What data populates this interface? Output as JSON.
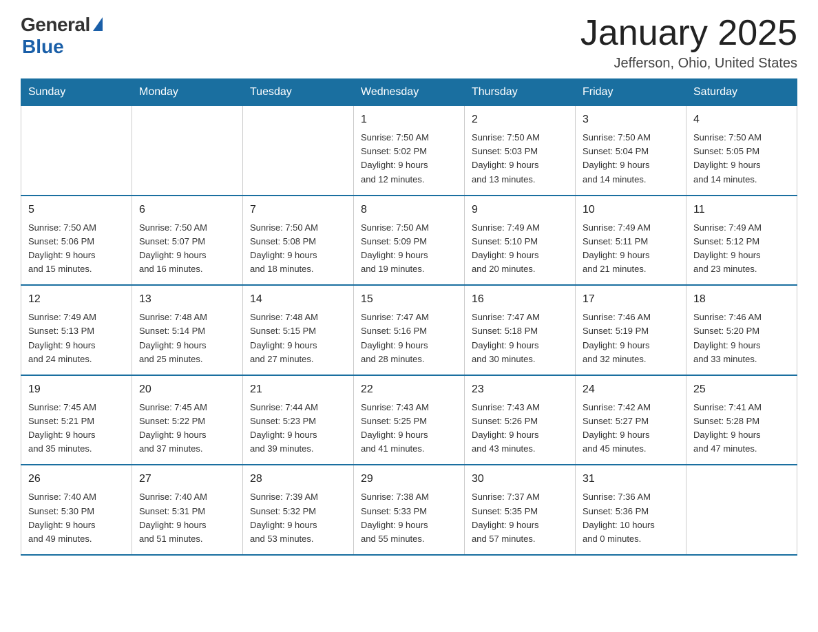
{
  "logo": {
    "general": "General",
    "blue": "Blue"
  },
  "title": "January 2025",
  "subtitle": "Jefferson, Ohio, United States",
  "header_days": [
    "Sunday",
    "Monday",
    "Tuesday",
    "Wednesday",
    "Thursday",
    "Friday",
    "Saturday"
  ],
  "weeks": [
    [
      {
        "day": "",
        "info": ""
      },
      {
        "day": "",
        "info": ""
      },
      {
        "day": "",
        "info": ""
      },
      {
        "day": "1",
        "info": "Sunrise: 7:50 AM\nSunset: 5:02 PM\nDaylight: 9 hours\nand 12 minutes."
      },
      {
        "day": "2",
        "info": "Sunrise: 7:50 AM\nSunset: 5:03 PM\nDaylight: 9 hours\nand 13 minutes."
      },
      {
        "day": "3",
        "info": "Sunrise: 7:50 AM\nSunset: 5:04 PM\nDaylight: 9 hours\nand 14 minutes."
      },
      {
        "day": "4",
        "info": "Sunrise: 7:50 AM\nSunset: 5:05 PM\nDaylight: 9 hours\nand 14 minutes."
      }
    ],
    [
      {
        "day": "5",
        "info": "Sunrise: 7:50 AM\nSunset: 5:06 PM\nDaylight: 9 hours\nand 15 minutes."
      },
      {
        "day": "6",
        "info": "Sunrise: 7:50 AM\nSunset: 5:07 PM\nDaylight: 9 hours\nand 16 minutes."
      },
      {
        "day": "7",
        "info": "Sunrise: 7:50 AM\nSunset: 5:08 PM\nDaylight: 9 hours\nand 18 minutes."
      },
      {
        "day": "8",
        "info": "Sunrise: 7:50 AM\nSunset: 5:09 PM\nDaylight: 9 hours\nand 19 minutes."
      },
      {
        "day": "9",
        "info": "Sunrise: 7:49 AM\nSunset: 5:10 PM\nDaylight: 9 hours\nand 20 minutes."
      },
      {
        "day": "10",
        "info": "Sunrise: 7:49 AM\nSunset: 5:11 PM\nDaylight: 9 hours\nand 21 minutes."
      },
      {
        "day": "11",
        "info": "Sunrise: 7:49 AM\nSunset: 5:12 PM\nDaylight: 9 hours\nand 23 minutes."
      }
    ],
    [
      {
        "day": "12",
        "info": "Sunrise: 7:49 AM\nSunset: 5:13 PM\nDaylight: 9 hours\nand 24 minutes."
      },
      {
        "day": "13",
        "info": "Sunrise: 7:48 AM\nSunset: 5:14 PM\nDaylight: 9 hours\nand 25 minutes."
      },
      {
        "day": "14",
        "info": "Sunrise: 7:48 AM\nSunset: 5:15 PM\nDaylight: 9 hours\nand 27 minutes."
      },
      {
        "day": "15",
        "info": "Sunrise: 7:47 AM\nSunset: 5:16 PM\nDaylight: 9 hours\nand 28 minutes."
      },
      {
        "day": "16",
        "info": "Sunrise: 7:47 AM\nSunset: 5:18 PM\nDaylight: 9 hours\nand 30 minutes."
      },
      {
        "day": "17",
        "info": "Sunrise: 7:46 AM\nSunset: 5:19 PM\nDaylight: 9 hours\nand 32 minutes."
      },
      {
        "day": "18",
        "info": "Sunrise: 7:46 AM\nSunset: 5:20 PM\nDaylight: 9 hours\nand 33 minutes."
      }
    ],
    [
      {
        "day": "19",
        "info": "Sunrise: 7:45 AM\nSunset: 5:21 PM\nDaylight: 9 hours\nand 35 minutes."
      },
      {
        "day": "20",
        "info": "Sunrise: 7:45 AM\nSunset: 5:22 PM\nDaylight: 9 hours\nand 37 minutes."
      },
      {
        "day": "21",
        "info": "Sunrise: 7:44 AM\nSunset: 5:23 PM\nDaylight: 9 hours\nand 39 minutes."
      },
      {
        "day": "22",
        "info": "Sunrise: 7:43 AM\nSunset: 5:25 PM\nDaylight: 9 hours\nand 41 minutes."
      },
      {
        "day": "23",
        "info": "Sunrise: 7:43 AM\nSunset: 5:26 PM\nDaylight: 9 hours\nand 43 minutes."
      },
      {
        "day": "24",
        "info": "Sunrise: 7:42 AM\nSunset: 5:27 PM\nDaylight: 9 hours\nand 45 minutes."
      },
      {
        "day": "25",
        "info": "Sunrise: 7:41 AM\nSunset: 5:28 PM\nDaylight: 9 hours\nand 47 minutes."
      }
    ],
    [
      {
        "day": "26",
        "info": "Sunrise: 7:40 AM\nSunset: 5:30 PM\nDaylight: 9 hours\nand 49 minutes."
      },
      {
        "day": "27",
        "info": "Sunrise: 7:40 AM\nSunset: 5:31 PM\nDaylight: 9 hours\nand 51 minutes."
      },
      {
        "day": "28",
        "info": "Sunrise: 7:39 AM\nSunset: 5:32 PM\nDaylight: 9 hours\nand 53 minutes."
      },
      {
        "day": "29",
        "info": "Sunrise: 7:38 AM\nSunset: 5:33 PM\nDaylight: 9 hours\nand 55 minutes."
      },
      {
        "day": "30",
        "info": "Sunrise: 7:37 AM\nSunset: 5:35 PM\nDaylight: 9 hours\nand 57 minutes."
      },
      {
        "day": "31",
        "info": "Sunrise: 7:36 AM\nSunset: 5:36 PM\nDaylight: 10 hours\nand 0 minutes."
      },
      {
        "day": "",
        "info": ""
      }
    ]
  ]
}
